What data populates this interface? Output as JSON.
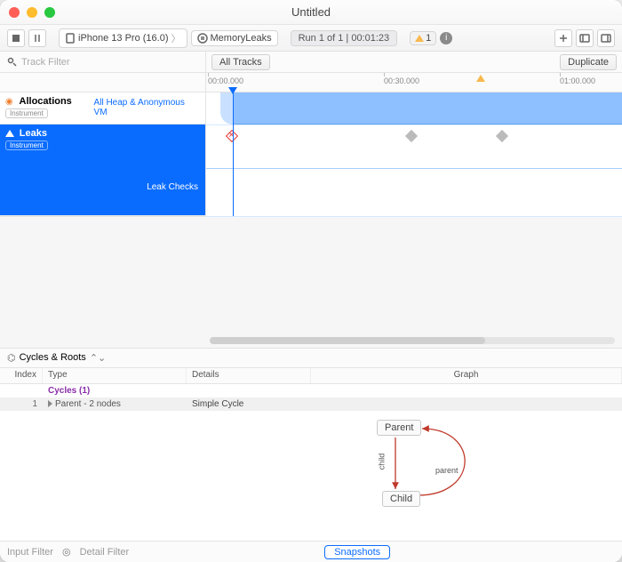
{
  "window": {
    "title": "Untitled"
  },
  "toolbar": {
    "device": "iPhone 13 Pro (16.0)",
    "project": "MemoryLeaks",
    "run_status": "Run 1 of 1  |  00:01:23",
    "warn_count": "1"
  },
  "filter": {
    "track_placeholder": "Track Filter",
    "all_tracks": "All Tracks",
    "duplicate": "Duplicate"
  },
  "ruler": {
    "t0": "00:00.000",
    "t1": "00:30.000",
    "t2": "01:00.000"
  },
  "tracks": {
    "alloc": {
      "name": "Allocations",
      "badge": "Instrument",
      "subtitle": "All Heap & Anonymous VM"
    },
    "leaks": {
      "name": "Leaks",
      "badge": "Instrument",
      "subtitle": "Leak Checks"
    }
  },
  "detail": {
    "view": "Cycles & Roots"
  },
  "table": {
    "cols": {
      "index": "Index",
      "type": "Type",
      "details": "Details",
      "graph": "Graph"
    },
    "group": "Cycles (1)",
    "row": {
      "index": "1",
      "type": "Parent - 2 nodes",
      "details": "Simple Cycle"
    }
  },
  "graph": {
    "nodeA": "Parent",
    "nodeB": "Child",
    "edgeAB": "child",
    "edgeBA": "parent"
  },
  "footer": {
    "input_filter": "Input Filter",
    "detail_placeholder": "Detail Filter",
    "snapshots": "Snapshots"
  }
}
